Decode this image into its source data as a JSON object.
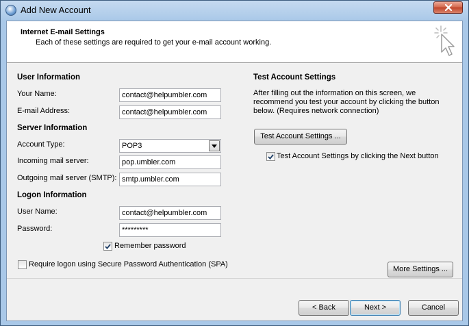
{
  "window": {
    "title": "Add New Account",
    "title_icon": "outlook-icon",
    "close_icon": "close-icon"
  },
  "header": {
    "title": "Internet E-mail Settings",
    "subtitle": "Each of these settings are required to get your e-mail account working.",
    "graphic_icon": "cursor-sparkle-icon"
  },
  "user_info": {
    "heading": "User Information",
    "name_label": "Your Name:",
    "name_value": "contact@helpumbler.com",
    "email_label": "E-mail Address:",
    "email_value": "contact@helpumbler.com"
  },
  "server_info": {
    "heading": "Server Information",
    "account_type_label": "Account Type:",
    "account_type_value": "POP3",
    "incoming_label": "Incoming mail server:",
    "incoming_value": "pop.umbler.com",
    "outgoing_label": "Outgoing mail server (SMTP):",
    "outgoing_value": "smtp.umbler.com"
  },
  "logon_info": {
    "heading": "Logon Information",
    "username_label": "User Name:",
    "username_value": "contact@helpumbler.com",
    "password_label": "Password:",
    "password_value": "*********",
    "remember_label": "Remember password",
    "remember_checked": true,
    "spa_label": "Require logon using Secure Password Authentication (SPA)",
    "spa_checked": false
  },
  "test_settings": {
    "heading": "Test Account Settings",
    "description_line1": "After filling out the information on this screen, we",
    "description_line2": "recommend you test your account by clicking the button",
    "description_line3": "below. (Requires network connection)",
    "test_button": "Test Account Settings ...",
    "next_checkbox_label": "Test Account Settings by clicking the Next button",
    "next_checkbox_checked": true
  },
  "buttons": {
    "more_settings": "More Settings ...",
    "back": "< Back",
    "next": "Next >",
    "cancel": "Cancel"
  }
}
